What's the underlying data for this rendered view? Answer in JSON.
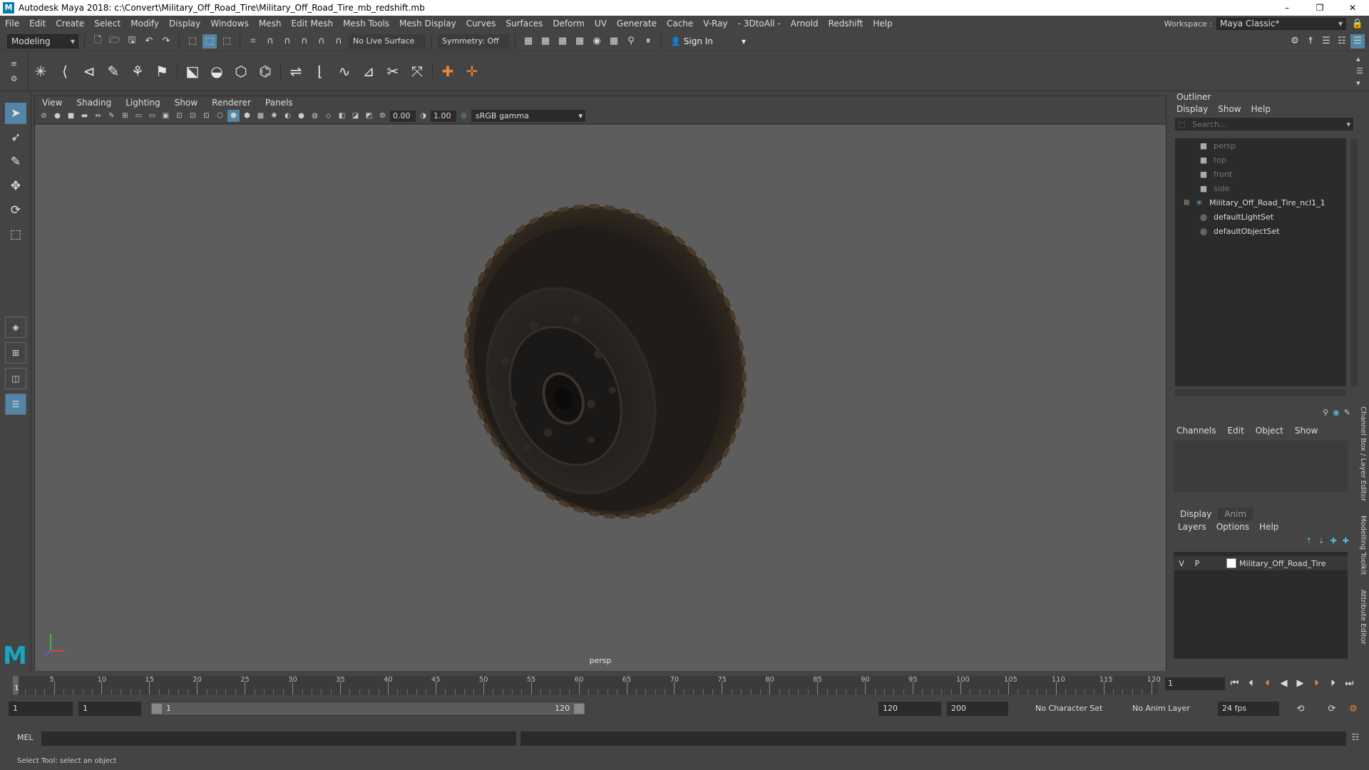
{
  "window": {
    "title": "Autodesk Maya 2018: c:\\Convert\\Military_Off_Road_Tire\\Military_Off_Road_Tire_mb_redshift.mb",
    "logo_letter": "M",
    "buttons": [
      "–",
      "❐",
      "✕"
    ]
  },
  "menubar": {
    "items": [
      "File",
      "Edit",
      "Create",
      "Select",
      "Modify",
      "Display",
      "Windows",
      "Mesh",
      "Edit Mesh",
      "Mesh Tools",
      "Mesh Display",
      "Curves",
      "Surfaces",
      "Deform",
      "UV",
      "Generate",
      "Cache",
      "V-Ray",
      "- 3DtoAll -",
      "Arnold",
      "Redshift",
      "Help"
    ],
    "workspace_label": "Workspace :",
    "workspace_value": "Maya Classic*"
  },
  "statusline": {
    "mode": "Modeling",
    "live_surface": "No Live Surface",
    "symmetry": "Symmetry: Off",
    "sign_in": "Sign In"
  },
  "viewport": {
    "menus": [
      "View",
      "Shading",
      "Lighting",
      "Show",
      "Renderer",
      "Panels"
    ],
    "exposure": "0.00",
    "gamma_value": "1.00",
    "color_space": "sRGB gamma",
    "camera_label": "persp"
  },
  "outliner": {
    "title": "Outliner",
    "menus": [
      "Display",
      "Show",
      "Help"
    ],
    "search_placeholder": "Search...",
    "items": [
      {
        "label": "persp",
        "type": "camera"
      },
      {
        "label": "top",
        "type": "camera"
      },
      {
        "label": "front",
        "type": "camera"
      },
      {
        "label": "side",
        "type": "camera"
      },
      {
        "label": "Military_Off_Road_Tire_ncl1_1",
        "type": "group"
      },
      {
        "label": "defaultLightSet",
        "type": "set"
      },
      {
        "label": "defaultObjectSet",
        "type": "set"
      }
    ]
  },
  "channel_box": {
    "menus": [
      "Channels",
      "Edit",
      "Object",
      "Show"
    ]
  },
  "layer_editor": {
    "tabs": [
      "Display",
      "Anim"
    ],
    "menus": [
      "Layers",
      "Options",
      "Help"
    ],
    "layer": {
      "v": "V",
      "p": "P",
      "name": "Military_Off_Road_Tire"
    }
  },
  "side_tabs": [
    "Channel Box / Layer Editor",
    "Modelling Toolkit",
    "Attribute Editor"
  ],
  "timeline": {
    "ticks": [
      "5",
      "10",
      "15",
      "20",
      "25",
      "30",
      "35",
      "40",
      "45",
      "50",
      "55",
      "60",
      "65",
      "70",
      "75",
      "80",
      "85",
      "90",
      "95",
      "100",
      "105",
      "110",
      "115",
      "120"
    ],
    "start_frame": "1",
    "current_frame": "1"
  },
  "range": {
    "start": "1",
    "anim_start": "1",
    "range_start": "1",
    "range_end": "120",
    "anim_end": "120",
    "end": "200",
    "character_set": "No Character Set",
    "anim_layer": "No Anim Layer",
    "fps": "24 fps"
  },
  "command": {
    "label": "MEL"
  },
  "help_line": "Select Tool: select an object"
}
